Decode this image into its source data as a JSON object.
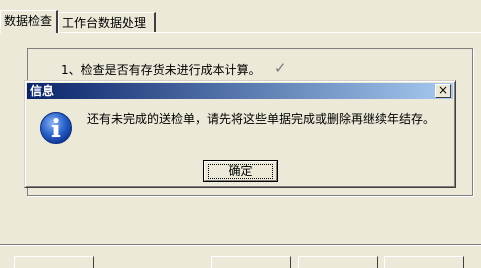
{
  "tabs": [
    {
      "label": "数据检查",
      "active": true
    },
    {
      "label": "工作台数据处理",
      "active": false
    }
  ],
  "check_items": [
    {
      "text": "1、检查是否有存货未进行成本计算。",
      "status_icon": "checkmark-icon"
    }
  ],
  "dialog": {
    "title": "信息",
    "close_glyph": "×",
    "message": "还有未完成的送检单，请先将这些单据完成或删除再继续年结存。",
    "icon": "info-icon",
    "ok_label": "确定"
  },
  "colors": {
    "titlebar_start": "#0a246a",
    "titlebar_end": "#a6caf0",
    "face": "#ece9d8",
    "info_blue": "#2a62c9"
  }
}
